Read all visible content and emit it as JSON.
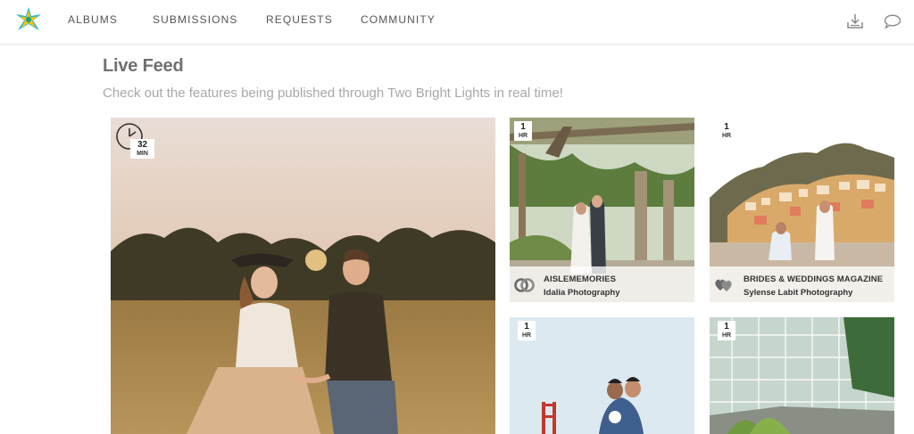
{
  "header": {
    "logo_icon": "star-logo-icon",
    "nav": [
      "ALBUMS",
      "SUBMISSIONS",
      "REQUESTS",
      "COMMUNITY"
    ],
    "icons": [
      "download-icon",
      "chat-bubble-icon"
    ]
  },
  "page": {
    "title": "Live Feed",
    "subtitle": "Check out the features being published through Two Bright Lights in real time!"
  },
  "feed": [
    {
      "time": "32",
      "unit": "MIN",
      "publication": "",
      "photographer": "",
      "photo": "couple-in-field-at-sunset"
    },
    {
      "time": "1",
      "unit": "HR",
      "publication": "AISLEMEMORIES",
      "photographer": "Idalia Photography",
      "photo": "wedding-couple-under-pergola"
    },
    {
      "time": "1",
      "unit": "HR",
      "publication": "BRIDES & WEDDINGS MAGAZINE",
      "photographer": "Sylense Labit Photography",
      "photo": "proposal-positano-coast"
    },
    {
      "time": "1",
      "unit": "HR",
      "publication": "",
      "photographer": "",
      "photo": "couple-near-golden-gate-bridge"
    },
    {
      "time": "1",
      "unit": "HR",
      "publication": "",
      "photographer": "",
      "photo": "greenhouse-conservatory"
    }
  ],
  "colors": {
    "accent_teal": "#28b5c5",
    "accent_yellow": "#f5c518",
    "title_gray": "#707070",
    "subtitle_gray": "#a8a8a8"
  }
}
